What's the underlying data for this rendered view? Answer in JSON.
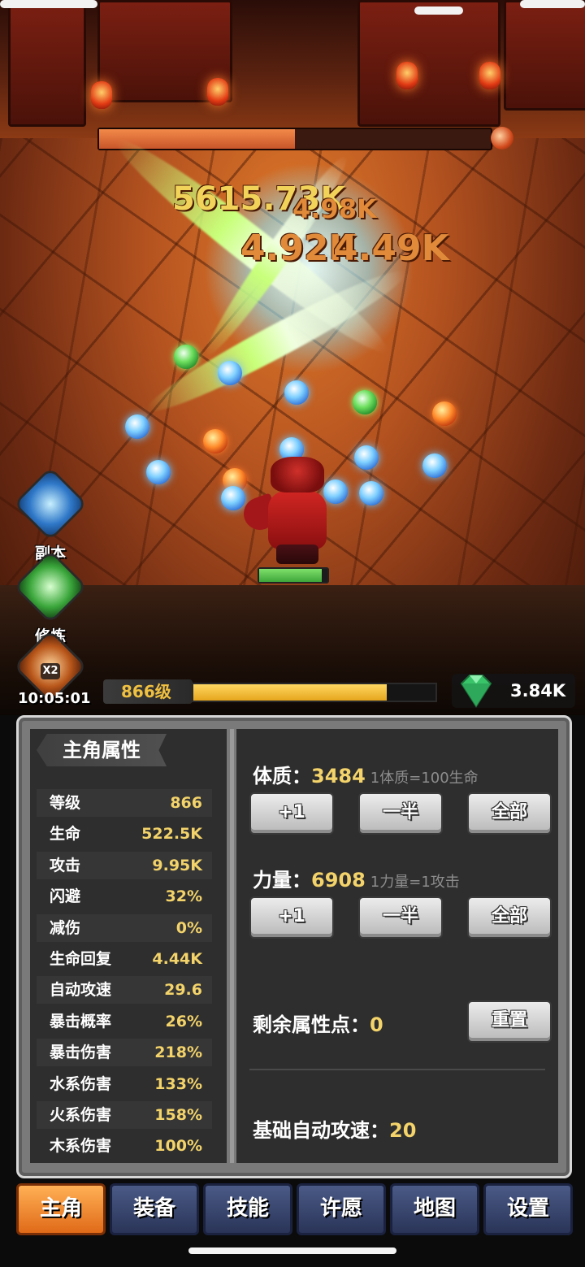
{
  "battle": {
    "damage_numbers": [
      "5615.73K",
      "4.98K",
      "4.92K",
      "4.49K"
    ],
    "timer": "10:05:01",
    "level_label": "866级",
    "xp_fraction": 0.8,
    "gems": "3.84K",
    "hero_hp_fraction": 0.92,
    "boss_hp_fraction": 0.5
  },
  "side_buttons": [
    {
      "label": "副本",
      "icon": "vortex-icon"
    },
    {
      "label": "修炼",
      "icon": "swirl-icon"
    },
    {
      "label": "",
      "icon": "double-reward-icon",
      "badge": "X2"
    }
  ],
  "panel": {
    "title": "主角属性",
    "stats": [
      {
        "label": "等级",
        "value": "866"
      },
      {
        "label": "生命",
        "value": "522.5K"
      },
      {
        "label": "攻击",
        "value": "9.95K"
      },
      {
        "label": "闪避",
        "value": "32%"
      },
      {
        "label": "减伤",
        "value": "0%"
      },
      {
        "label": "生命回复",
        "value": "4.44K"
      },
      {
        "label": "自动攻速",
        "value": "29.6"
      },
      {
        "label": "暴击概率",
        "value": "26%"
      },
      {
        "label": "暴击伤害",
        "value": "218%"
      },
      {
        "label": "水系伤害",
        "value": "133%"
      },
      {
        "label": "火系伤害",
        "value": "158%"
      },
      {
        "label": "木系伤害",
        "value": "100%"
      }
    ],
    "constitution": {
      "label": "体质：",
      "value": "3484",
      "hint": "1体质=100生命"
    },
    "strength": {
      "label": "力量：",
      "value": "6908",
      "hint": "1力量=1攻击"
    },
    "buttons": {
      "plus_one": "+1",
      "half": "一半",
      "all": "全部",
      "reset": "重置"
    },
    "remaining": {
      "label": "剩余属性点：",
      "value": "0"
    },
    "base_speed": {
      "label": "基础自动攻速：",
      "value": "20"
    }
  },
  "tabs": [
    "主角",
    "装备",
    "技能",
    "许愿",
    "地图",
    "设置"
  ],
  "active_tab": "主角",
  "colors": {
    "accent_gold": "#f3d36a",
    "tab_active": "#e06a18",
    "tab_inactive": "#2a3458",
    "xp": "#e6a51c"
  }
}
